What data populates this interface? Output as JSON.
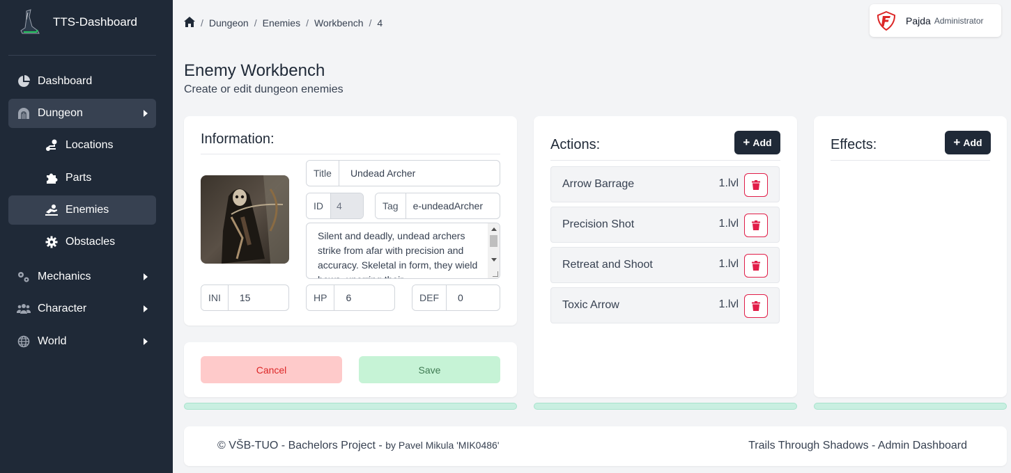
{
  "app": {
    "title": "TTS-Dashboard"
  },
  "sidebar": {
    "items": [
      {
        "label": "Dashboard"
      },
      {
        "label": "Dungeon"
      },
      {
        "label": "Locations"
      },
      {
        "label": "Parts"
      },
      {
        "label": "Enemies"
      },
      {
        "label": "Obstacles"
      },
      {
        "label": "Mechanics"
      },
      {
        "label": "Character"
      },
      {
        "label": "World"
      }
    ]
  },
  "breadcrumb": {
    "items": [
      "Dungeon",
      "Enemies",
      "Workbench",
      "4"
    ]
  },
  "user": {
    "name": "Pajda",
    "role": "Administrator"
  },
  "page": {
    "title": "Enemy Workbench",
    "subtitle": "Create or edit dungeon enemies"
  },
  "information": {
    "heading": "Information:",
    "title_label": "Title",
    "title_value": "Undead Archer",
    "id_label": "ID",
    "id_value": "4",
    "tag_label": "Tag",
    "tag_value": "e-undeadArcher",
    "description": "Silent and deadly, undead archers strike from afar with precision and accuracy. Skeletal in form, they wield bows, unerring their",
    "ini_label": "INI",
    "ini_value": "15",
    "hp_label": "HP",
    "hp_value": "6",
    "def_label": "DEF",
    "def_value": "0"
  },
  "buttons": {
    "cancel": "Cancel",
    "save": "Save",
    "add": "Add"
  },
  "actions": {
    "heading": "Actions:",
    "items": [
      {
        "name": "Arrow Barrage",
        "level": "1.lvl"
      },
      {
        "name": "Precision Shot",
        "level": "1.lvl"
      },
      {
        "name": "Retreat and Shoot",
        "level": "1.lvl"
      },
      {
        "name": "Toxic Arrow",
        "level": "1.lvl"
      }
    ]
  },
  "effects": {
    "heading": "Effects:"
  },
  "footer": {
    "left": "© VŠB-TUO - Bachelors Project - ",
    "left_by": "by Pavel Mikula 'MIK0486'",
    "right": "Trails Through Shadows - Admin Dashboard"
  },
  "colors": {
    "sidebar_bg": "#1f2937",
    "accent_dark": "#1f2937",
    "danger": "#e11d48",
    "cancel_bg": "#fecaca",
    "save_bg": "#c6f3d6"
  }
}
